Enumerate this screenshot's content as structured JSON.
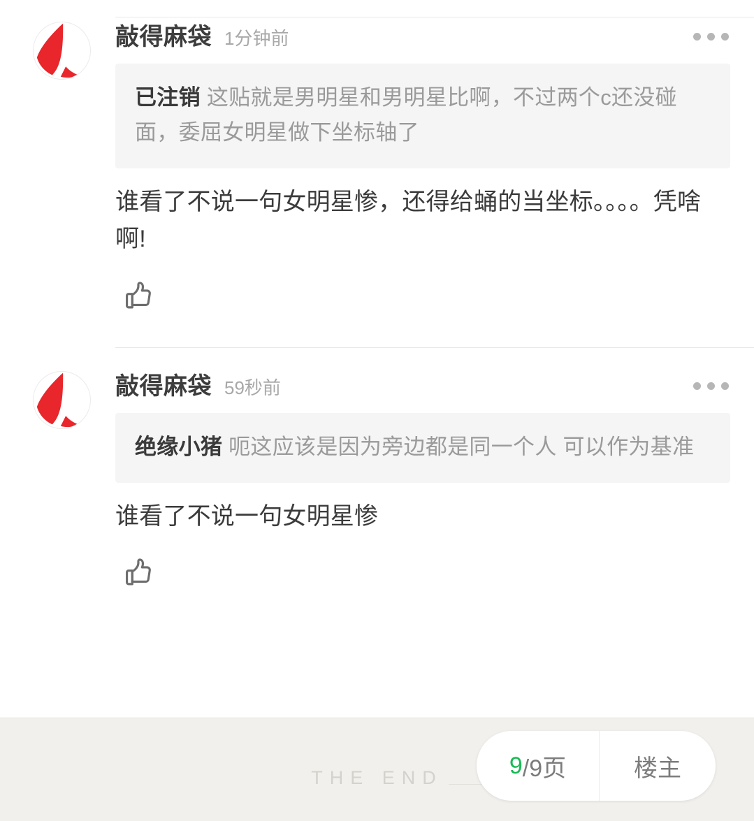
{
  "theme": {
    "page_bg": "#ffffff",
    "footer_bg": "#f2f0ec",
    "quote_bg": "#f5f5f5",
    "accent_green": "#19b955",
    "avatar_red": "#e8262b",
    "text_primary": "#3b3b3b",
    "text_muted": "#9a9a9a"
  },
  "comments": [
    {
      "avatar_name": "avatar-qiaodemadai",
      "username": "敲得麻袋",
      "timestamp": "1分钟前",
      "more_label": "•••",
      "quote": {
        "author": "已注销",
        "text": "这贴就是男明星和男明星比啊，不过两个c还没碰面，委屈女明星做下坐标轴了"
      },
      "reply": "谁看了不说一句女明星惨，还得给蛹的当坐标。。。。凭啥啊!",
      "like_icon": "thumbs-up-icon"
    },
    {
      "avatar_name": "avatar-qiaodemadai",
      "username": "敲得麻袋",
      "timestamp": "59秒前",
      "more_label": "•••",
      "quote": {
        "author": "绝缘小猪",
        "text": "呃这应该是因为旁边都是同一个人 可以作为基准"
      },
      "reply": "谁看了不说一句女明星惨",
      "like_icon": "thumbs-up-icon"
    }
  ],
  "footer": {
    "end_text": "THE END",
    "pager": {
      "current_page": "9",
      "page_total_suffix": "/9页",
      "owner_label": "楼主"
    }
  }
}
